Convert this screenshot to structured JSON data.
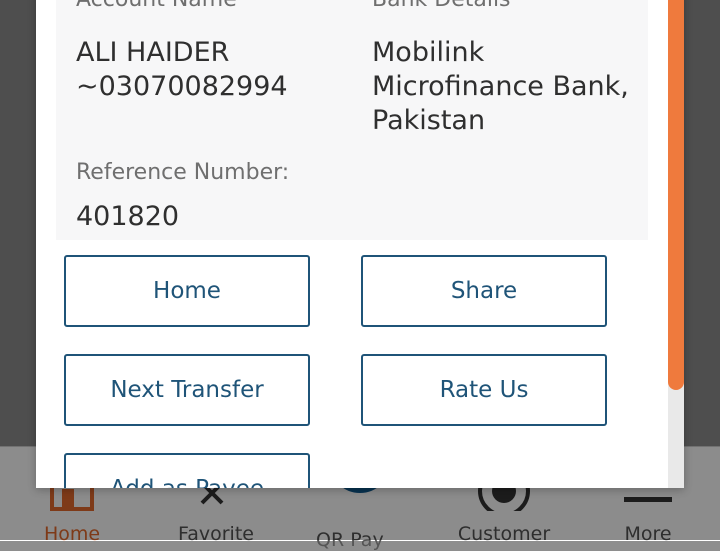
{
  "colors": {
    "accent": "#ef7a3d",
    "button_text": "#1f5478",
    "nav_active": "#e56a2c",
    "qr_button": "#0d5b93"
  },
  "details": {
    "account_name_label": "Account Name",
    "account_name_line1": "ALI HAIDER",
    "account_name_line2": "~03070082994",
    "bank_details_label": "Bank Details",
    "bank_line1": "Mobilink",
    "bank_line2": "Microfinance Bank,",
    "bank_line3": "Pakistan",
    "reference_label": "Reference Number:",
    "reference_value": "401820"
  },
  "actions": {
    "home": "Home",
    "share": "Share",
    "next_transfer": "Next Transfer",
    "rate_us": "Rate Us",
    "add_as_payee": "Add as Payee"
  },
  "bottom_nav": {
    "home": "Home",
    "favorite": "Favorite",
    "qr_label": "QR Pay",
    "customer": "Customer",
    "more": "More"
  }
}
